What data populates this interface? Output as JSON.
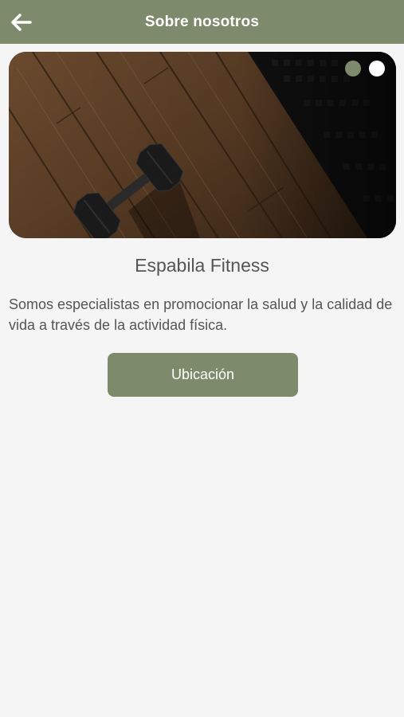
{
  "header": {
    "title": "Sobre nosotros",
    "back_icon": "arrow-left-icon"
  },
  "carousel": {
    "image_subject": "dumbbell-on-wooden-floor",
    "slide_count": 2,
    "active_slide": 1,
    "dot_colors": [
      "#7d8b6c",
      "#ffffff"
    ]
  },
  "content": {
    "title": "Espabila Fitness",
    "description": "Somos especialistas en promocionar la salud y la calidad de vida a través de la actividad física.",
    "location_button": "Ubicación"
  },
  "colors": {
    "accent": "#7d8b6c",
    "background": "#f5f5f5",
    "text": "#555555"
  }
}
